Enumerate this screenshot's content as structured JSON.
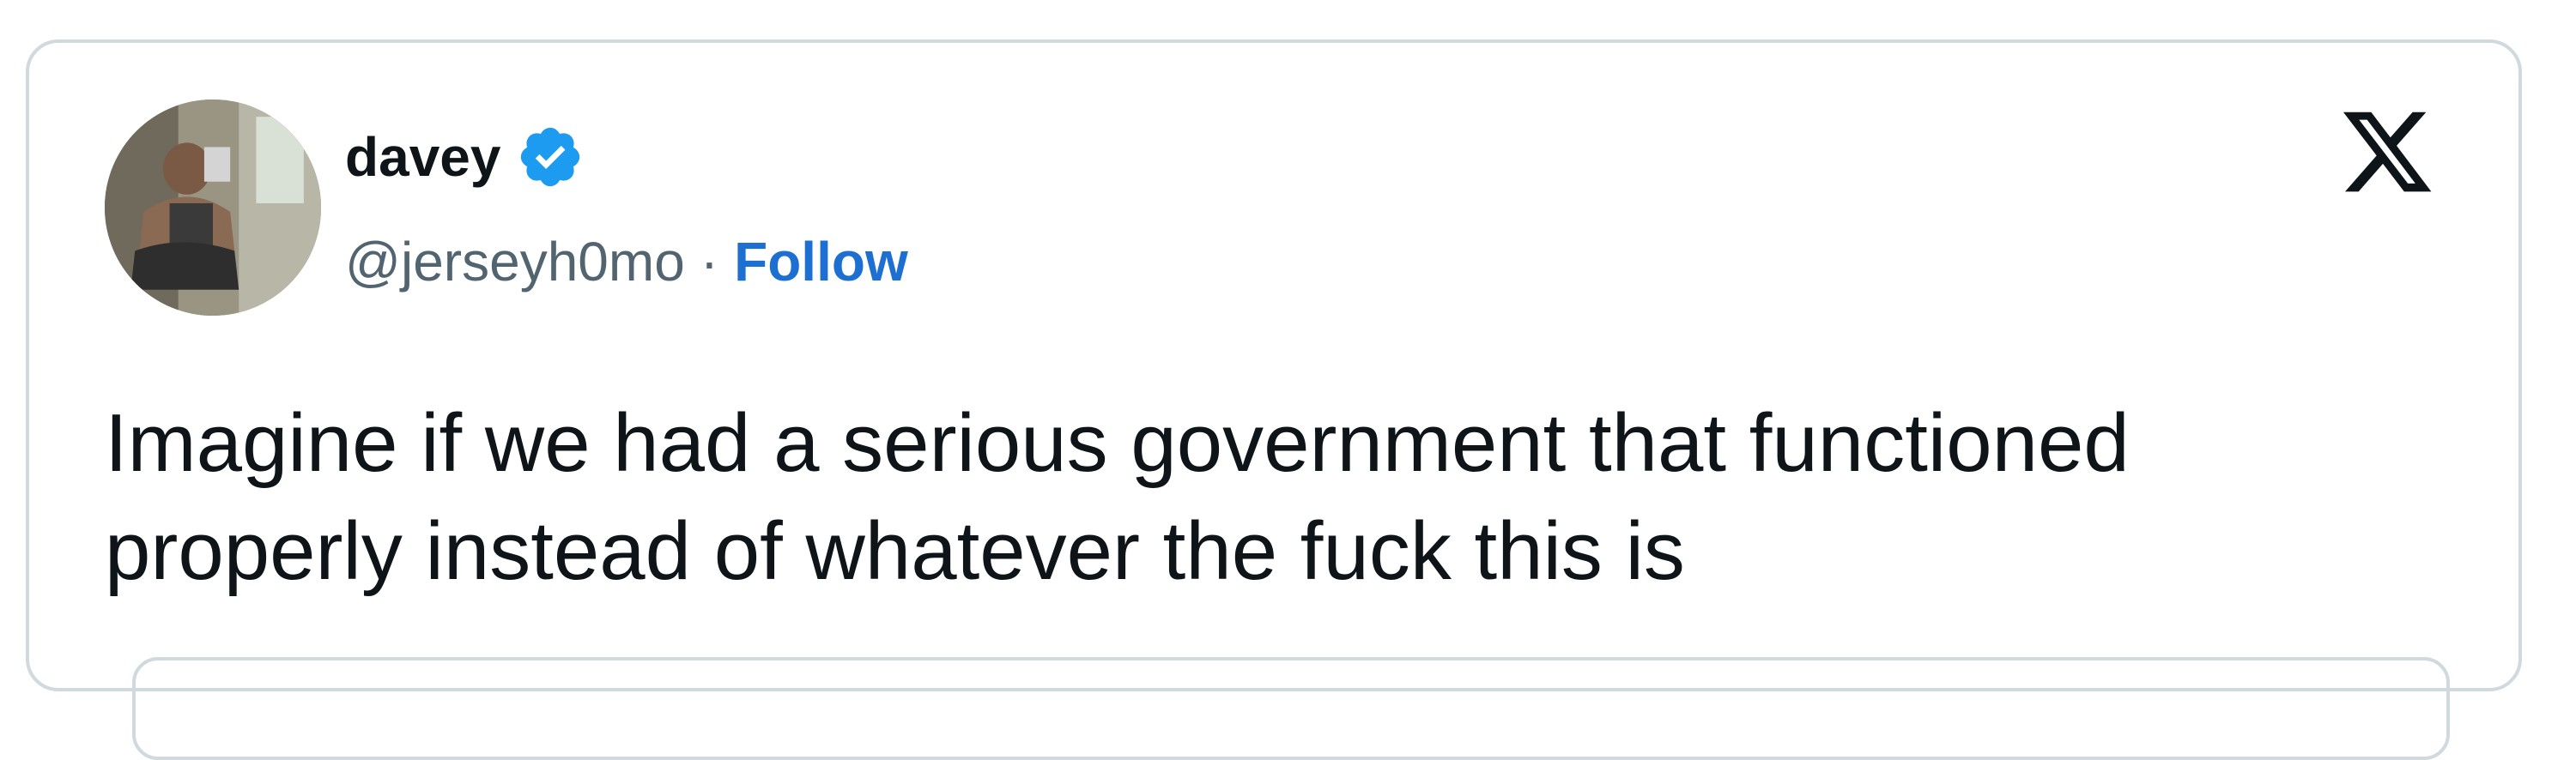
{
  "tweet": {
    "author": {
      "display_name": "davey",
      "handle": "@jerseyh0mo",
      "verified": true,
      "verified_icon": "verified-badge-icon"
    },
    "separator": "·",
    "follow_label": "Follow",
    "platform_logo": "x-logo-icon",
    "text": "Imagine if we had a serious government that functioned properly instead of whatever the fuck this is"
  },
  "colors": {
    "text": "#0f1419",
    "secondary_text": "#536471",
    "link": "#1d6fd1",
    "verified": "#1d9bf0",
    "border": "#cfd9de"
  }
}
